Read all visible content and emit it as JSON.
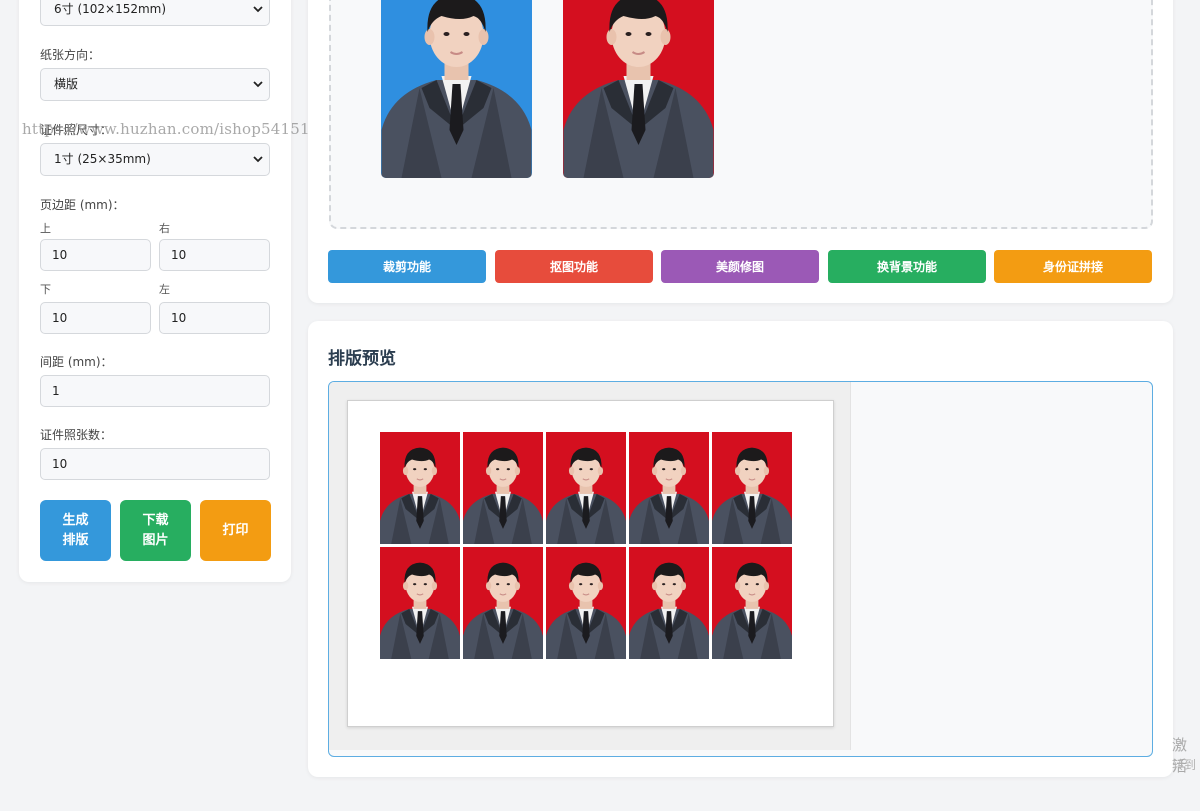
{
  "settings": {
    "paper_size": {
      "value": "6寸 (102×152mm)"
    },
    "orientation": {
      "label": "纸张方向：",
      "value": "横版"
    },
    "photo_size": {
      "label": "证件照尺寸：",
      "value": "1寸 (25×35mm)"
    },
    "margins": {
      "label": "页边距 (mm)：",
      "top_label": "上",
      "top": "10",
      "right_label": "右",
      "right": "10",
      "bottom_label": "下",
      "bottom": "10",
      "left_label": "左",
      "left": "10"
    },
    "spacing": {
      "label": "间距 (mm)：",
      "value": "1"
    },
    "count": {
      "label": "证件照张数：",
      "value": "10"
    },
    "buttons": {
      "generate": "生成\n排版",
      "generate_line1": "生成",
      "generate_line2": "排版",
      "download_line1": "下载",
      "download_line2": "图片",
      "print": "打印"
    }
  },
  "watermark": "https://www.huzhan.com/ishop54151",
  "upload_previews": [
    {
      "background": "#2f8fe0",
      "name": "blue-background-photo"
    },
    {
      "background": "#d40f1f",
      "name": "red-background-photo"
    }
  ],
  "functions": [
    {
      "label": "裁剪功能",
      "color": "#3498db"
    },
    {
      "label": "抠图功能",
      "color": "#e74c3c"
    },
    {
      "label": "美颜修图",
      "color": "#9b59b6"
    },
    {
      "label": "换背景功能",
      "color": "#27ae60"
    },
    {
      "label": "身份证拼接",
      "color": "#f39c12"
    }
  ],
  "layout_preview": {
    "title": "排版预览",
    "rows": 2,
    "cols": 5,
    "photo_background": "#d40f1f"
  },
  "windows_notice": {
    "line1": "激活",
    "line2": "转到"
  },
  "colors": {
    "blue": "#3498db",
    "green": "#27ae60",
    "orange": "#f39c12",
    "accent_border": "#5dade2"
  }
}
